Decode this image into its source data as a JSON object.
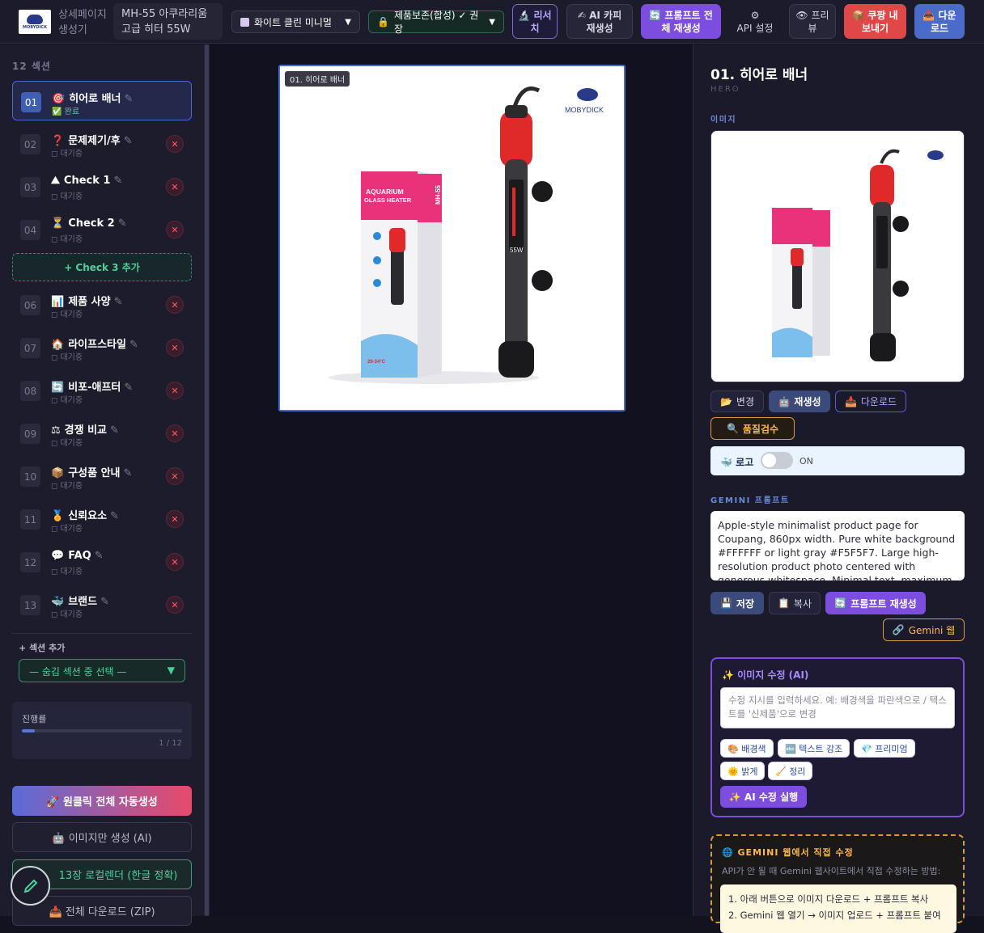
{
  "topbar": {
    "logo_text": "MOBYDICK",
    "app_title": "상세페이지 생성기",
    "product_name": "MH-55 아쿠라리움 고급 히터 55W",
    "template_select": "화이트 클린 미니멀",
    "mode_select": "제품보존(합성) ✓ 권장",
    "buttons": {
      "research": "리서치",
      "ai_copy": "AI 카피 재생성",
      "prompt_regen": "프롬프트 전체 재생성",
      "api_settings": "API 설정",
      "preview": "프리뷰",
      "coupang_export": "쿠팡 내보내기",
      "download": "다운로드"
    },
    "icons": {
      "template": "palette-icon",
      "mode": "lock-icon",
      "research": "microscope-icon",
      "ai_copy": "pen-icon",
      "prompt_regen": "refresh-icon",
      "api_settings": "gear-icon",
      "preview": "eye-icon",
      "coupang_export": "box-icon",
      "download": "download-icon"
    }
  },
  "sidebar": {
    "count_label": "12 섹션",
    "sections": [
      {
        "num": "01",
        "icon": "🎯",
        "title": "히어로 배너",
        "status": "완료",
        "done": true,
        "active": true
      },
      {
        "num": "02",
        "icon": "❓",
        "title": "문제제기/후",
        "status": "대기중",
        "done": false
      },
      {
        "num": "03",
        "icon": "⛰",
        "title": "Check 1",
        "status": "대기중",
        "done": false
      },
      {
        "num": "04",
        "icon": "⏳",
        "title": "Check 2",
        "status": "대기중",
        "done": false
      },
      {
        "num": "06",
        "icon": "📊",
        "title": "제품 사양",
        "status": "대기중",
        "done": false
      },
      {
        "num": "07",
        "icon": "🏠",
        "title": "라이프스타일",
        "status": "대기중",
        "done": false
      },
      {
        "num": "08",
        "icon": "🔄",
        "title": "비포-애프터",
        "status": "대기중",
        "done": false
      },
      {
        "num": "09",
        "icon": "⚖",
        "title": "경쟁 비교",
        "status": "대기중",
        "done": false
      },
      {
        "num": "10",
        "icon": "📦",
        "title": "구성품 안내",
        "status": "대기중",
        "done": false
      },
      {
        "num": "11",
        "icon": "🏅",
        "title": "신뢰요소",
        "status": "대기중",
        "done": false
      },
      {
        "num": "12",
        "icon": "💬",
        "title": "FAQ",
        "status": "대기중",
        "done": false
      },
      {
        "num": "13",
        "icon": "🐳",
        "title": "브랜드",
        "status": "대기중",
        "done": false
      }
    ],
    "add_check_label": "+ Check 3 추가",
    "add_section_label": "+ 섹션 추가",
    "hidden_select_placeholder": "— 숨김 섹션 중 선택 —",
    "progress_label": "진행률",
    "progress_count": "1 / 12",
    "progress_fraction": 0.083,
    "buttons": {
      "one_click": "🚀 원클릭 전체 자동생성",
      "images_only": "🤖 이미지만 생성 (AI)",
      "localize": "13장 로컬렌더 (한글 정확)",
      "download_zip": "📥 전체 다운로드 (ZIP)"
    }
  },
  "canvas": {
    "hero_tag": "01. 히어로 배너",
    "product_box_text": {
      "line1": "AQUARIUM",
      "line2": "GLASS HEATER",
      "model": "MH-55",
      "temp": "20-34°C",
      "brand_logo": "MOBYDICK",
      "watt": "55W"
    }
  },
  "panel": {
    "title": "01. 히어로 배너",
    "subtitle": "HERO",
    "image_label": "이미지",
    "buttons": {
      "change": "변경",
      "regen": "재생성",
      "download": "다운로드",
      "quality": "품질검수",
      "save": "저장",
      "copy": "복사",
      "prompt_regen": "프롬프트 재생성",
      "gemini_web": "Gemini 웹"
    },
    "logo_label": "로고",
    "logo_state": "ON",
    "gemini_label": "GEMINI 프롬프트",
    "prompt_text": "Apple-style minimalist product page for Coupang, 860px width. Pure white background #FFFFFF or light gray #F5F5F7. Large high-resolution product photo centered with generous whitespace. Minimal text, maximum visual impact. Dark charcoal",
    "ai_edit": {
      "header": "✨ 이미지 수정 (AI)",
      "placeholder": "수정 지시를 입력하세요. 예: 배경색을 파란색으로 / 텍스트를 '신제품'으로 변경",
      "pills": [
        "🎨 배경색",
        "🔤 텍스트 강조",
        "💎 프리미엄",
        "🌞 밝게",
        "🧹 정리"
      ],
      "run": "✨ AI 수정 실행"
    },
    "gemini_web_box": {
      "header": "🌐 GEMINI 웹에서 직접 수정",
      "desc": "API가 안 될 때 Gemini 웹사이트에서 직접 수정하는 방법:",
      "step1": "1. 아래 버튼으로 이미지 다운로드 + 프롬프트 복사",
      "step2": "2. Gemini 웹 열기 → 이미지 업로드 + 프롬프트 붙여"
    }
  },
  "colors": {
    "accent_blue": "#4a6cc8",
    "accent_purple": "#7c4dde",
    "success_green": "#4ad19a",
    "danger_red": "#e04848",
    "warning_orange": "#d89a3a"
  }
}
